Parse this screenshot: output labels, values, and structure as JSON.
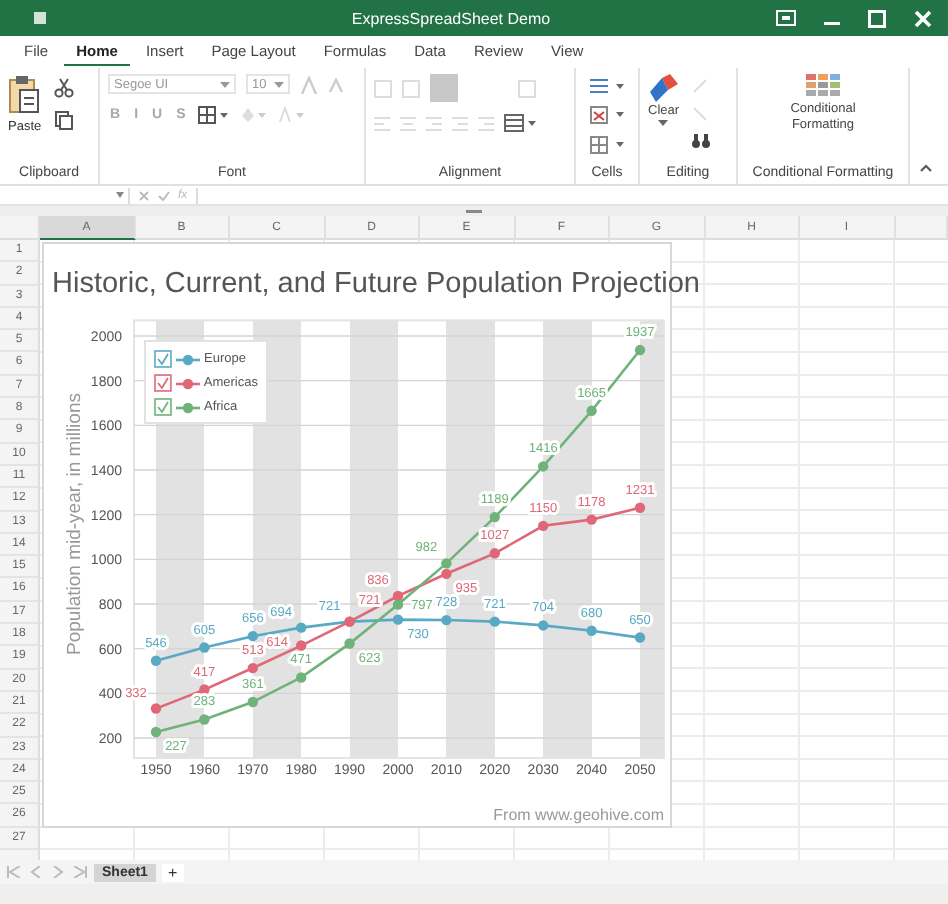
{
  "window": {
    "title": "ExpressSpreadSheet Demo"
  },
  "tabs": [
    {
      "label": "File",
      "selected": false
    },
    {
      "label": "Home",
      "selected": true
    },
    {
      "label": "Insert",
      "selected": false
    },
    {
      "label": "Page Layout",
      "selected": false
    },
    {
      "label": "Formulas",
      "selected": false
    },
    {
      "label": "Data",
      "selected": false
    },
    {
      "label": "Review",
      "selected": false
    },
    {
      "label": "View",
      "selected": false
    }
  ],
  "ribbon": {
    "clipboard": {
      "label": "Clipboard",
      "paste": "Paste"
    },
    "font": {
      "label": "Font",
      "font_name": "Segoe UI",
      "font_size": "10",
      "buttons": [
        {
          "label": "B",
          "disabled": true
        },
        {
          "label": "I",
          "disabled": true
        },
        {
          "label": "U",
          "disabled": true
        },
        {
          "label": "S",
          "disabled": true
        }
      ]
    },
    "alignment": {
      "label": "Alignment"
    },
    "cells": {
      "label": "Cells"
    },
    "editing": {
      "label": "Editing",
      "clear": "Clear"
    },
    "conditional": {
      "label": "Conditional Formatting",
      "button": "Conditional Formatting"
    }
  },
  "formula_bar": {
    "function_label": "fx"
  },
  "columns": [
    {
      "label": "A",
      "selected": true
    },
    {
      "label": "B",
      "selected": false
    },
    {
      "label": "C",
      "selected": false
    },
    {
      "label": "D",
      "selected": false
    },
    {
      "label": "E",
      "selected": false
    },
    {
      "label": "F",
      "selected": false
    },
    {
      "label": "G",
      "selected": false
    },
    {
      "label": "H",
      "selected": false
    },
    {
      "label": "I",
      "selected": false
    }
  ],
  "rows": [
    "1",
    "2",
    "3",
    "4",
    "5",
    "6",
    "7",
    "8",
    "9",
    "10",
    "11",
    "12",
    "13",
    "14",
    "15",
    "16",
    "17",
    "18",
    "19",
    "20",
    "21",
    "22",
    "23",
    "24",
    "25",
    "26",
    "27"
  ],
  "chart": {
    "source": "From www.geohive.com",
    "chart_data": {
      "type": "line",
      "title": "Historic, Current, and Future Population Projection",
      "ylabel": "Population mid-year, in millions",
      "categories": [
        "1950",
        "1960",
        "1970",
        "1980",
        "1990",
        "2000",
        "2010",
        "2020",
        "2030",
        "2040",
        "2050"
      ],
      "yticks": [
        200,
        400,
        600,
        800,
        1000,
        1200,
        1400,
        1600,
        1800,
        2000
      ],
      "ylim": [
        110,
        2070
      ],
      "data_labels": true,
      "grid": true,
      "series": [
        {
          "name": "Europe",
          "color": "#5aa9c4",
          "marker": "circle",
          "values": [
            546,
            605,
            656,
            694,
            721,
            730,
            728,
            721,
            704,
            680,
            650
          ]
        },
        {
          "name": "Americas",
          "color": "#e06777",
          "marker": "circle",
          "values": [
            332,
            417,
            513,
            614,
            721,
            836,
            935,
            1027,
            1150,
            1178,
            1231
          ]
        },
        {
          "name": "Africa",
          "color": "#6fb37a",
          "marker": "circle",
          "values": [
            227,
            283,
            361,
            471,
            623,
            797,
            982,
            1189,
            1416,
            1665,
            1937
          ]
        }
      ]
    }
  },
  "sheet_tabs": [
    {
      "label": "Sheet1",
      "selected": true
    }
  ],
  "add_sheet": "+"
}
